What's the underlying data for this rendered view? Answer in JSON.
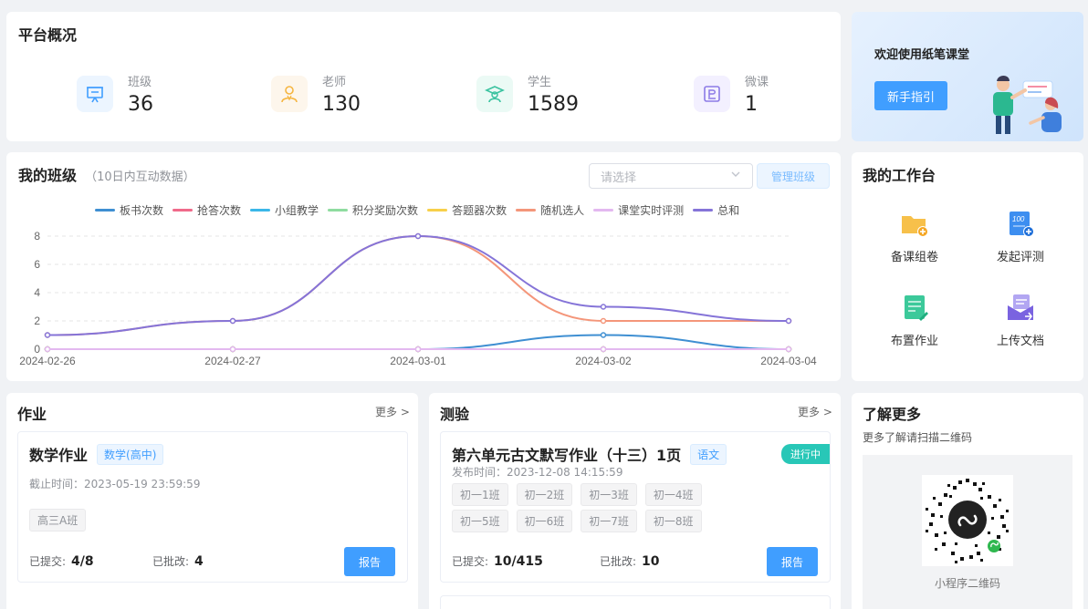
{
  "overview": {
    "title": "平台概况",
    "stats": [
      {
        "label": "班级",
        "value": "36",
        "icon": "presentation-board-icon",
        "color": "#409eff",
        "bg": "#ecf5ff"
      },
      {
        "label": "老师",
        "value": "130",
        "icon": "teacher-icon",
        "color": "#f5b540",
        "bg": "#fdf6ec"
      },
      {
        "label": "学生",
        "value": "1589",
        "icon": "student-cap-icon",
        "color": "#3bc3a0",
        "bg": "#ebfaf5"
      },
      {
        "label": "微课",
        "value": "1",
        "icon": "micro-course-icon",
        "color": "#8c7ae6",
        "bg": "#f3f0ff"
      }
    ]
  },
  "welcome": {
    "title": "欢迎使用纸笔课堂",
    "guide_button": "新手指引"
  },
  "my_class": {
    "title": "我的班级",
    "subtitle": "（10日内互动数据）",
    "select_placeholder": "请选择",
    "manage_button": "管理班级"
  },
  "chart_data": {
    "type": "line",
    "x": [
      "2024-02-26",
      "2024-02-27",
      "2024-03-01",
      "2024-03-02",
      "2024-03-04"
    ],
    "ylim": [
      0,
      8
    ],
    "yticks": [
      "0",
      "2",
      "4",
      "6",
      "8"
    ],
    "grid": true,
    "legend_position": "top",
    "series": [
      {
        "name": "板书次数",
        "color": "#3f8fd2",
        "values": [
          0,
          0,
          0,
          1,
          0
        ]
      },
      {
        "name": "抢答次数",
        "color": "#f06a8a",
        "values": [
          0,
          0,
          0,
          0,
          0
        ]
      },
      {
        "name": "小组教学",
        "color": "#3bb7e8",
        "values": [
          0,
          0,
          0,
          0,
          0
        ]
      },
      {
        "name": "积分奖励次数",
        "color": "#8fdca0",
        "values": [
          0,
          0,
          0,
          0,
          0
        ]
      },
      {
        "name": "答题器次数",
        "color": "#f7d04a",
        "values": [
          0,
          0,
          0,
          0,
          0
        ]
      },
      {
        "name": "随机选人",
        "color": "#f4967a",
        "values": [
          1,
          2,
          8,
          2,
          2
        ]
      },
      {
        "name": "课堂实时评测",
        "color": "#e3b8f0",
        "values": [
          0,
          0,
          0,
          0,
          0
        ]
      },
      {
        "name": "总和",
        "color": "#8574d8",
        "values": [
          1,
          2,
          8,
          3,
          2
        ]
      }
    ]
  },
  "workbench": {
    "title": "我的工作台",
    "items": [
      {
        "label": "备课组卷",
        "icon": "folder-add-icon"
      },
      {
        "label": "发起评测",
        "icon": "test-score-icon"
      },
      {
        "label": "布置作业",
        "icon": "assign-homework-icon"
      },
      {
        "label": "上传文档",
        "icon": "upload-document-icon"
      }
    ]
  },
  "homework": {
    "title": "作业",
    "more": "更多 >",
    "card": {
      "name": "数学作业",
      "subject": "数学(高中)",
      "deadline": "截止时间：2023-05-19 23:59:59",
      "class_tag": "高三A班",
      "submitted_label": "已提交:",
      "submitted_value": "4/8",
      "graded_label": "已批改:",
      "graded_value": "4",
      "report_button": "报告"
    }
  },
  "quiz": {
    "title": "测验",
    "more": "更多 >",
    "card": {
      "name": "第六单元古文默写作业（十三）1页",
      "subject": "语文",
      "status": "进行中",
      "published": "发布时间：2023-12-08 14:15:59",
      "classes": [
        "初一1班",
        "初一2班",
        "初一3班",
        "初一4班",
        "初一5班",
        "初一6班",
        "初一7班",
        "初一8班"
      ],
      "submitted_label": "已提交:",
      "submitted_value": "10/415",
      "graded_label": "已批改:",
      "graded_value": "10",
      "report_button": "报告"
    }
  },
  "learn_more": {
    "title": "了解更多",
    "desc": "更多了解请扫描二维码",
    "qr_caption": "小程序二维码"
  }
}
